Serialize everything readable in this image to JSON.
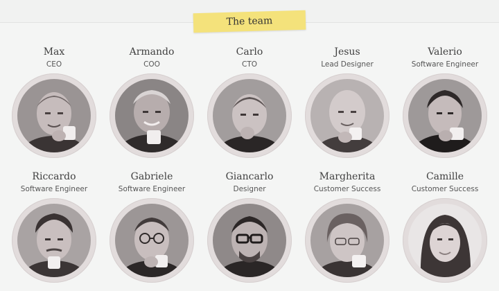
{
  "section": {
    "title": "The team"
  },
  "members": [
    {
      "name": "Max",
      "role": "CEO"
    },
    {
      "name": "Armando",
      "role": "COO"
    },
    {
      "name": "Carlo",
      "role": "CTO"
    },
    {
      "name": "Jesus",
      "role": "Lead Designer"
    },
    {
      "name": "Valerio",
      "role": "Software Engineer"
    },
    {
      "name": "Riccardo",
      "role": "Software Engineer"
    },
    {
      "name": "Gabriele",
      "role": "Software Engineer"
    },
    {
      "name": "Giancarlo",
      "role": "Designer"
    },
    {
      "name": "Margherita",
      "role": "Customer Success"
    },
    {
      "name": "Camille",
      "role": "Customer Success"
    }
  ],
  "colors": {
    "tag": "#f4e27b",
    "ring": "#e2dcdc",
    "background": "#f4f5f4"
  }
}
